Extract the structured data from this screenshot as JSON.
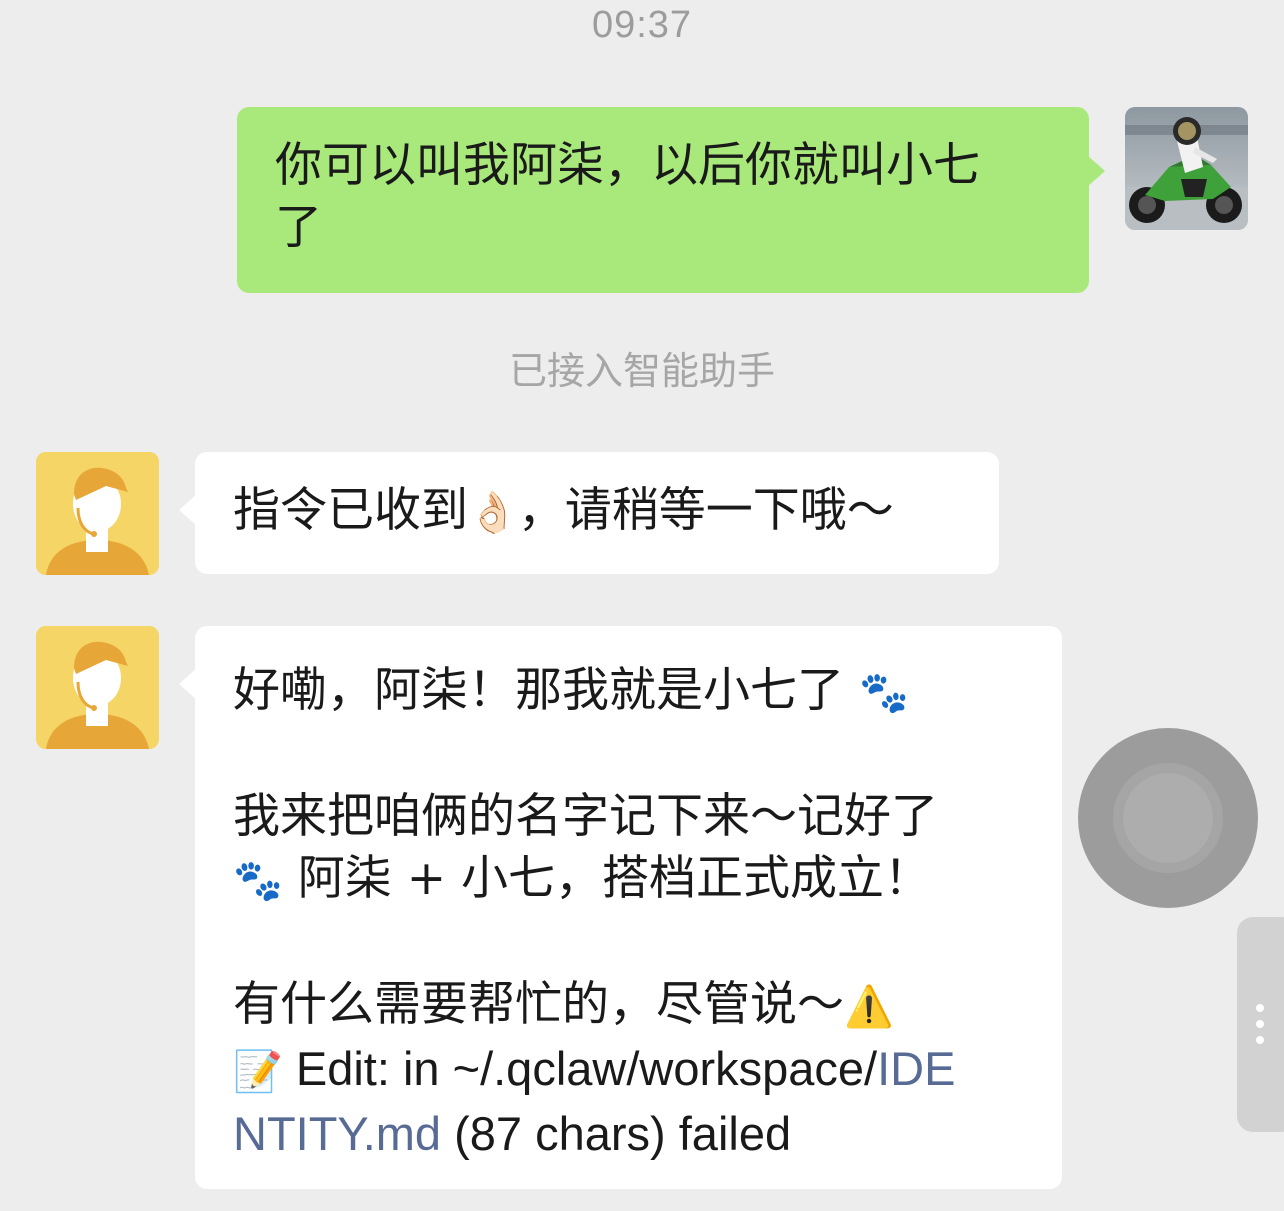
{
  "chat": {
    "timestamp": "09:37",
    "system_note": "已接入智能助手",
    "messages": [
      {
        "sender": "user",
        "lines": [
          "你可以叫我阿柒，以后你就叫小七",
          "了"
        ]
      },
      {
        "sender": "bot",
        "text": "指令已收到",
        "emoji": "👌🏻",
        "text_after": "，请稍等一下哦～"
      },
      {
        "sender": "bot",
        "line1": "好嘞，阿柒！那我就是小七了",
        "line1_emoji": "🐾",
        "line2": "我来把咱俩的名字记下来～记好了",
        "line3_emoji": "🐾",
        "line3": "阿柒 + 小七，搭档正式成立！",
        "line4": "有什么需要帮忙的，尽管说～",
        "line4_emoji": "⚠️",
        "line5_emoji": "📝",
        "line5_text": "Edit: in ~/.qclaw/workspace/",
        "line5_link": "IDE",
        "line6_link": "NTITY.md",
        "line6_text": " (87 chars) failed"
      }
    ]
  },
  "colors": {
    "background": "#ededed",
    "outgoing_bubble": "#a9e97c",
    "incoming_bubble": "#ffffff",
    "link": "#576b95",
    "bot_avatar": "#f5d565"
  },
  "icons": {
    "user_avatar": "motorcycle-rider-avatar",
    "bot_avatar": "assistant-headset-avatar",
    "floating_button": "assistive-touch-icon",
    "side_handle": "more-vertical-icon"
  }
}
